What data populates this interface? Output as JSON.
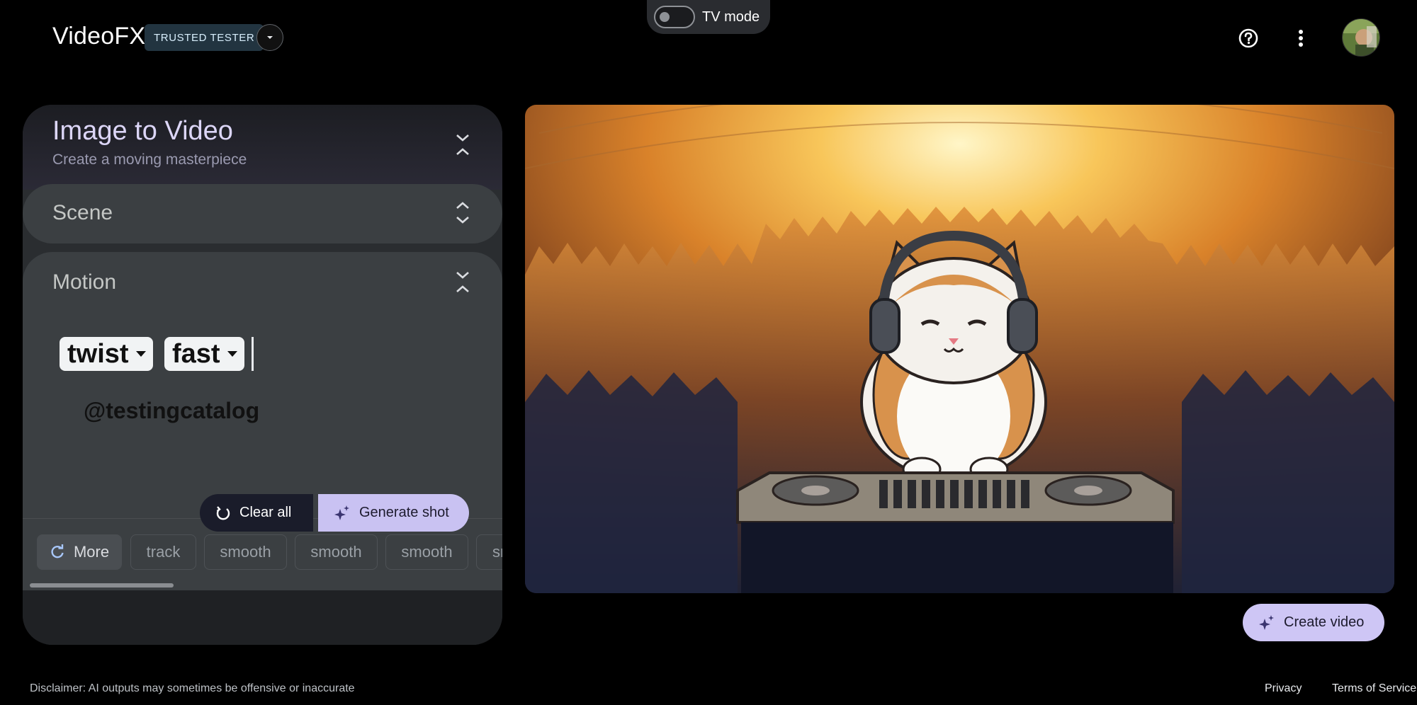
{
  "header": {
    "logo": "VideoFX",
    "badge": "TRUSTED TESTER",
    "tv_mode_label": "TV mode",
    "icons": [
      "chevron-down-icon",
      "help-icon",
      "more-vert-icon",
      "avatar"
    ]
  },
  "panel": {
    "title": "Image to Video",
    "subtitle": "Create a moving masterpiece",
    "sections": {
      "scene": "Scene",
      "motion": "Motion"
    },
    "prompt_chips": [
      {
        "label": "twist"
      },
      {
        "label": "fast"
      }
    ],
    "watermark": "@testingcatalog",
    "suggestions": {
      "more_label": "More",
      "items": [
        "track",
        "smooth",
        "smooth",
        "smooth",
        "sm"
      ]
    },
    "buttons": {
      "clear": "Clear all",
      "generate": "Generate shot"
    }
  },
  "preview": {
    "create_label": "Create video"
  },
  "footer": {
    "disclaimer": "Disclaimer: AI outputs may sometimes be offensive or inaccurate",
    "privacy": "Privacy",
    "terms": "Terms of Service"
  },
  "colors": {
    "accent": "#c9c2f2",
    "panel": "#2a2d30",
    "section": "#3b3f42",
    "badge_bg": "#223440"
  }
}
